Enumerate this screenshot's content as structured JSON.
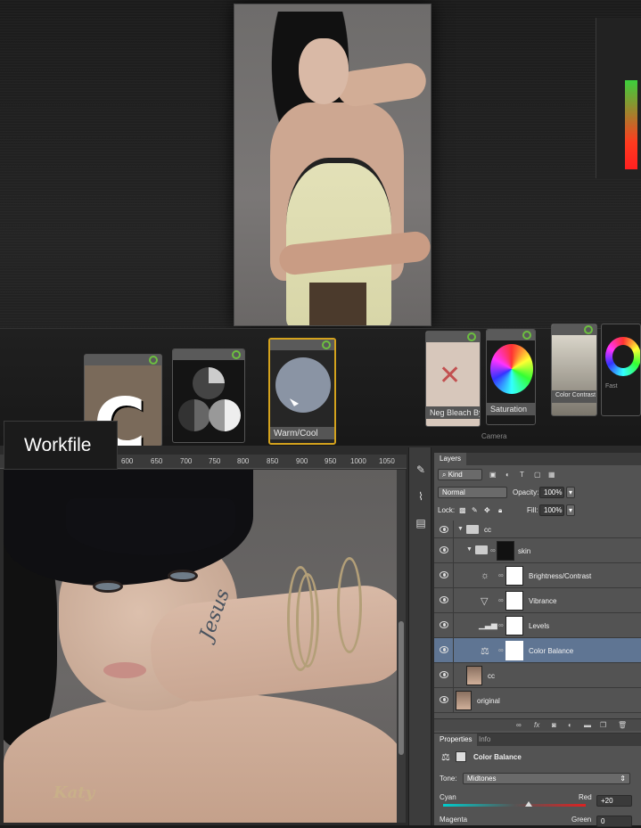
{
  "top_app": {
    "cards": [
      {
        "label": ""
      },
      {
        "label": ""
      },
      {
        "label": "Warm/Cool"
      },
      {
        "label": "Neg Bleach Bypass"
      },
      {
        "label": "Saturation"
      },
      {
        "label": "Color Contrast"
      },
      {
        "label": "Camera"
      },
      {
        "label": "Fast"
      }
    ],
    "card_glyph": "C"
  },
  "workfile_label": "Workfile",
  "ruler": {
    "ticks": [
      "600",
      "650",
      "700",
      "750",
      "800",
      "850",
      "900",
      "950",
      "1000",
      "1050"
    ]
  },
  "canvas": {
    "tattoo": "Jesus",
    "necklace": "Katy"
  },
  "toolstrip": {
    "collapse_glyph": "◂◂"
  },
  "layers_panel": {
    "tab": "Layers",
    "filter_label": "Kind",
    "blend_mode": "Normal",
    "opacity_label": "Opacity:",
    "opacity_value": "100%",
    "lock_label": "Lock:",
    "fill_label": "Fill:",
    "fill_value": "100%",
    "layers": [
      {
        "name": "cc",
        "kind": "group"
      },
      {
        "name": "skin",
        "kind": "group"
      },
      {
        "name": "Brightness/Contrast",
        "kind": "adjustment"
      },
      {
        "name": "Vibrance",
        "kind": "adjustment"
      },
      {
        "name": "Levels",
        "kind": "adjustment"
      },
      {
        "name": "Color Balance",
        "kind": "adjustment"
      },
      {
        "name": "cc",
        "kind": "pixel"
      },
      {
        "name": "original",
        "kind": "pixel"
      }
    ]
  },
  "properties_panel": {
    "tabs": [
      "Properties",
      "Info"
    ],
    "title": "Color Balance",
    "tone_label": "Tone:",
    "tone_value": "Midtones",
    "sliders": [
      {
        "left": "Cyan",
        "right": "Red",
        "value": "+20",
        "position": 0.6
      },
      {
        "left": "Magenta",
        "right": "Green",
        "value": "0",
        "position": 0.5
      }
    ]
  }
}
